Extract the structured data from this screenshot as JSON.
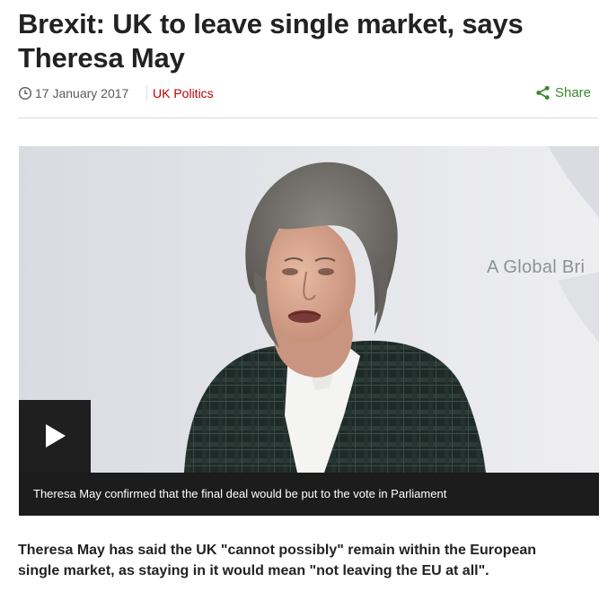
{
  "article": {
    "headline": "Brexit: UK to leave single market, says Theresa May",
    "date": "17 January 2017",
    "topic": "UK Politics",
    "share_label": "Share",
    "media": {
      "backdrop_text": "A Global Bri",
      "caption": "Theresa May confirmed that the final deal would be put to the vote in Parliament"
    },
    "summary": "Theresa May has said the UK \"cannot possibly\" remain within the European single market, as staying in it would mean \"not leaving the EU at all\"."
  },
  "colors": {
    "topic_link": "#b80000",
    "share_accent": "#3a8a2b",
    "caption_bar": "#1c1c1c",
    "play_button": "#1f1f1f"
  },
  "icons": {
    "date": "clock-icon",
    "share": "share-icon",
    "media": "play-icon"
  }
}
